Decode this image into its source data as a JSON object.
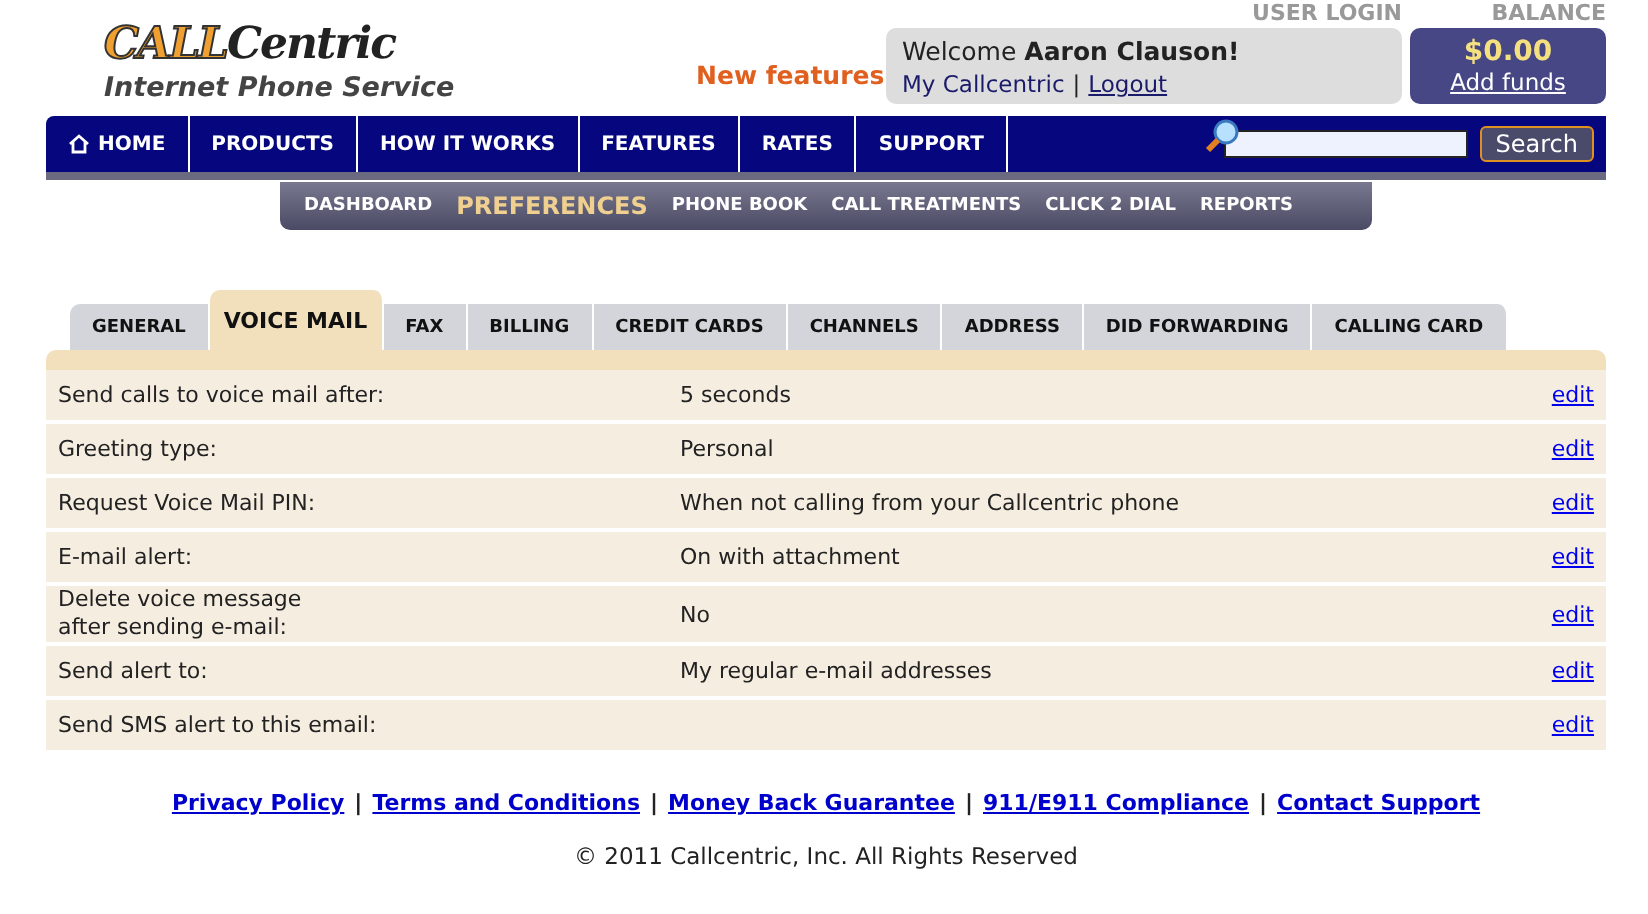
{
  "logo": {
    "brand_first": "CALL",
    "brand_second": "Centric",
    "tagline": "Internet Phone Service"
  },
  "new_features": "New features",
  "user_login": {
    "heading": "USER LOGIN",
    "welcome": "Welcome",
    "name": "Aaron Clauson!",
    "links": [
      "My Callcentric",
      "Logout"
    ],
    "separator": "|"
  },
  "balance": {
    "heading": "BALANCE",
    "amount": "$0.00",
    "link": "Add funds"
  },
  "nav": [
    {
      "label": "HOME",
      "kind": "home"
    },
    {
      "label": "PRODUCTS",
      "kind": "plain"
    },
    {
      "label": "HOW IT WORKS",
      "kind": "plain"
    },
    {
      "label": "FEATURES",
      "kind": "plain"
    },
    {
      "label": "RATES",
      "kind": "plain"
    },
    {
      "label": "SUPPORT",
      "kind": "plain"
    }
  ],
  "search": {
    "button": "Search"
  },
  "subnav": [
    {
      "label": "DASHBOARD",
      "selected": false
    },
    {
      "label": "PREFERENCES",
      "selected": true
    },
    {
      "label": "PHONE BOOK",
      "selected": false
    },
    {
      "label": "CALL TREATMENTS",
      "selected": false
    },
    {
      "label": "CLICK 2 DIAL",
      "selected": false
    },
    {
      "label": "REPORTS",
      "selected": false
    }
  ],
  "tabs": [
    {
      "label": "GENERAL",
      "selected": false
    },
    {
      "label": "VOICE MAIL",
      "selected": true
    },
    {
      "label": "FAX",
      "selected": false
    },
    {
      "label": "BILLING",
      "selected": false
    },
    {
      "label": "CREDIT CARDS",
      "selected": false
    },
    {
      "label": "CHANNELS",
      "selected": false
    },
    {
      "label": "ADDRESS",
      "selected": false
    },
    {
      "label": "DID FORWARDING",
      "selected": false
    },
    {
      "label": "CALLING CARD",
      "selected": false
    }
  ],
  "settings": [
    {
      "label": "Send calls to voice mail after:",
      "value": "5 seconds",
      "action": "edit"
    },
    {
      "label": "Greeting type:",
      "value": "Personal",
      "action": "edit"
    },
    {
      "label": "Request Voice Mail PIN:",
      "value": "When not calling from your Callcentric phone",
      "action": "edit"
    },
    {
      "label": "E-mail alert:",
      "value": "On with attachment",
      "action": "edit"
    },
    {
      "label": "Delete voice message\nafter sending e-mail:",
      "value": "No",
      "action": "edit"
    },
    {
      "label": "Send alert to:",
      "value": "My regular e-mail addresses",
      "action": "edit"
    },
    {
      "label": "Send SMS alert to this email:",
      "action": "edit"
    }
  ],
  "footer": {
    "links": [
      "Privacy Policy",
      "Terms and Conditions",
      "Money Back Guarantee",
      "911/E911 Compliance",
      "Contact Support"
    ],
    "separator": "|",
    "copyright": "© 2011 Callcentric, Inc. All Rights Reserved"
  }
}
